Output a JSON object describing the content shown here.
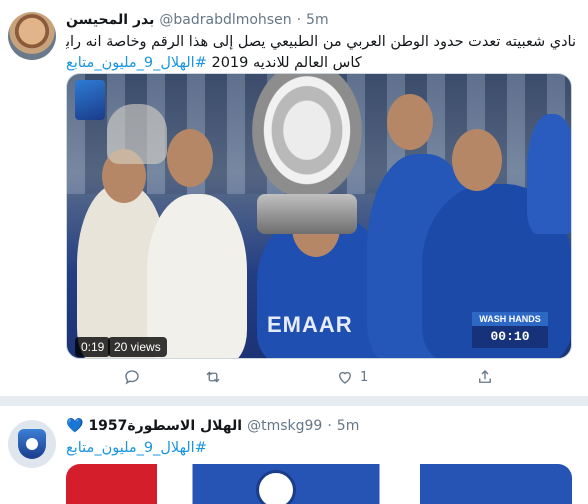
{
  "tweet1": {
    "display_name": "بدر المحيسن",
    "handle": "@badrabdlmohsen",
    "dot": "·",
    "time": "5m",
    "text_line1": "نادي شعبيته تعدت حدود الوطن العربي من الطبيعي يصل إلى هذا الرقم وخاصة انه رابع اندية العالم في",
    "text_line2_plain": "كاس العالم للانديه 2019 ",
    "hashtag": "#الهلال_9_مليون_متابع",
    "video": {
      "duration": "0:19",
      "views": "20 views",
      "jersey_text": "EMAAR",
      "overlay_top": "WASH HANDS",
      "overlay_clock": "00:10"
    },
    "actions": {
      "reply_icon": "reply-icon",
      "retweet_icon": "retweet-icon",
      "like_icon": "like-icon",
      "like_count": "1",
      "share_icon": "share-icon"
    }
  },
  "tweet2": {
    "display_name": "الهلال الاسطورة1957",
    "heart": "💙",
    "handle": "@tmskg99",
    "dot": "·",
    "time": "5m",
    "hashtag": "#الهلال_9_مليون_متابع"
  },
  "colors": {
    "link": "#1b95e0",
    "muted": "#657786",
    "divider": "#e6ecf0"
  }
}
